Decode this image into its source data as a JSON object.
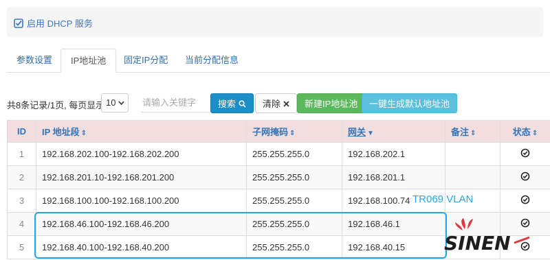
{
  "dhcp": {
    "label": "启用 DHCP 服务",
    "checked": true
  },
  "tabs": [
    {
      "label": "参数设置"
    },
    {
      "label": "IP地址池"
    },
    {
      "label": "固定IP分配"
    },
    {
      "label": "当前分配信息"
    }
  ],
  "toolbar": {
    "record_info": "共8条记录/1页, 每页显示",
    "page_size": "10",
    "search_placeholder": "请输入关键字",
    "search_label": "搜索",
    "clear_label": "清除",
    "new_pool_label": "新建IP地址池",
    "generate_label": "一键生成默认地址池"
  },
  "table": {
    "headers": [
      "ID",
      "IP 地址段",
      "子网掩码",
      "网关",
      "备注",
      "状态"
    ],
    "rows": [
      {
        "id": "1",
        "range": "192.168.202.100-192.168.202.200",
        "mask": "255.255.255.0",
        "gateway": "192.168.202.1",
        "note": ""
      },
      {
        "id": "2",
        "range": "192.168.201.10-192.168.201.200",
        "mask": "255.255.255.0",
        "gateway": "192.168.201.1",
        "note": ""
      },
      {
        "id": "3",
        "range": "192.168.100.100-192.168.100.200",
        "mask": "255.255.255.0",
        "gateway": "192.168.100.74",
        "note": ""
      },
      {
        "id": "4",
        "range": "192.168.46.100-192.168.46.200",
        "mask": "255.255.255.0",
        "gateway": "192.168.46.1",
        "note": ""
      },
      {
        "id": "5",
        "range": "192.168.40.100-192.168.40.200",
        "mask": "255.255.255.0",
        "gateway": "192.168.40.15",
        "note": ""
      }
    ]
  },
  "annotation": "TR069 VLAN",
  "colors": {
    "accent": "#29a6e6",
    "link": "#3474b8",
    "header_bg": "#f2dede",
    "search_btn": "#1b8fc8",
    "new_btn": "#5cb85c",
    "gen_btn": "#5bc0de"
  }
}
